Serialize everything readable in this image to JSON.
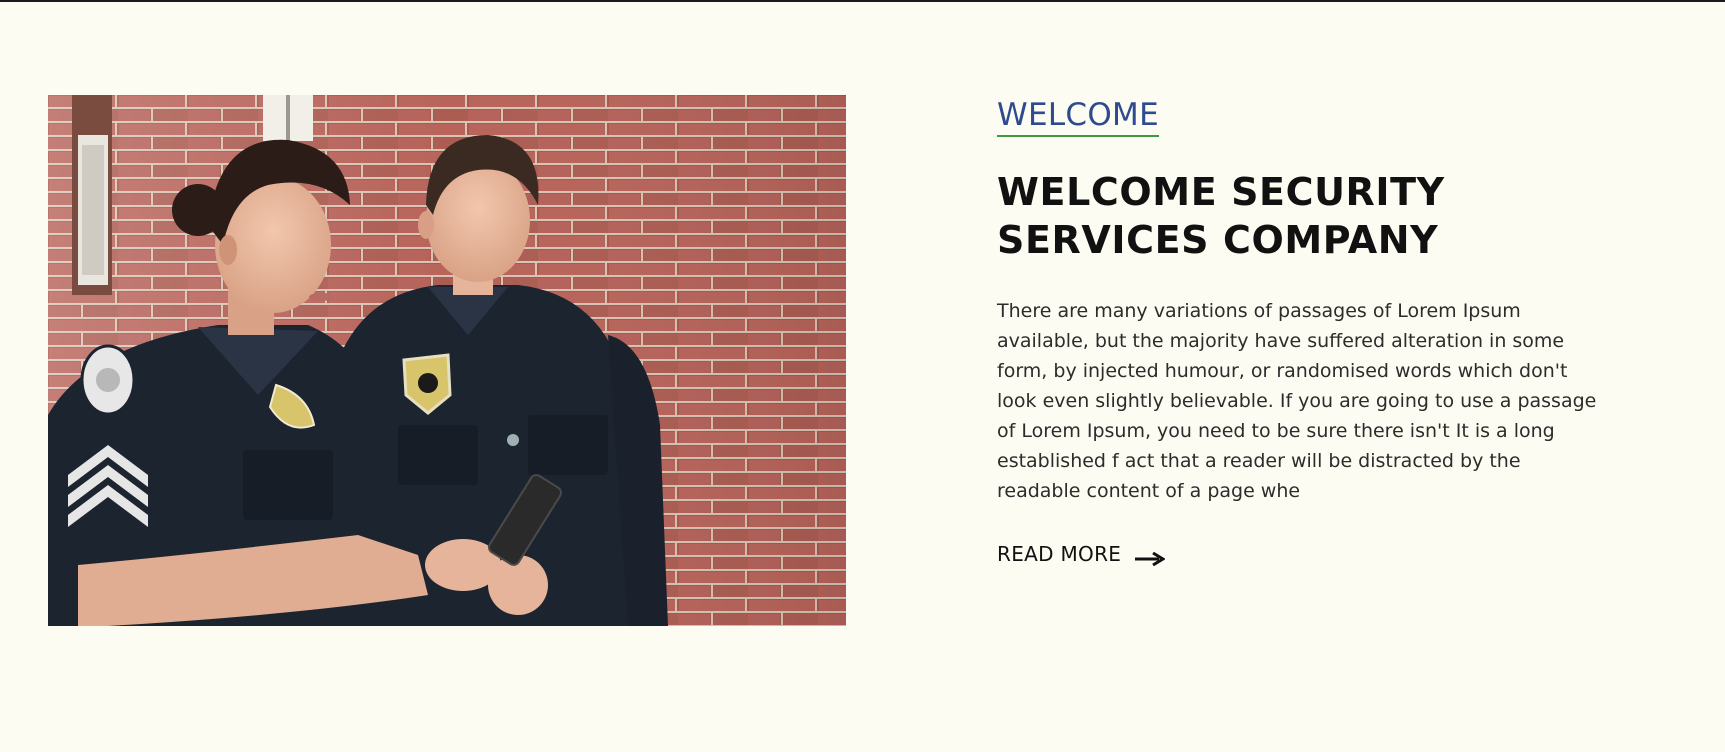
{
  "about": {
    "eyebrow": "WELCOME",
    "heading": "WELCOME SECURITY SERVICES COMPANY",
    "body": "There are many variations of passages of Lorem Ipsum available, but the majority have suffered alteration in some form, by injected humour, or randomised words which don't look even slightly believable. If you are going to use a passage of Lorem Ipsum, you need to be sure there isn't It is a long established f act that a reader will be distracted by the readable content of a page whe",
    "read_more_label": "READ MORE",
    "read_more_icon": "arrow-right-icon",
    "image_alt": "security-officers-photo"
  },
  "colors": {
    "background": "#fdfcf2",
    "eyebrow_text": "#2f4b8f",
    "eyebrow_underline": "#3c9a3c",
    "heading_text": "#111111",
    "body_text": "#2c2c2c",
    "brick": "#a85b4c",
    "uniform": "#1c2430"
  }
}
